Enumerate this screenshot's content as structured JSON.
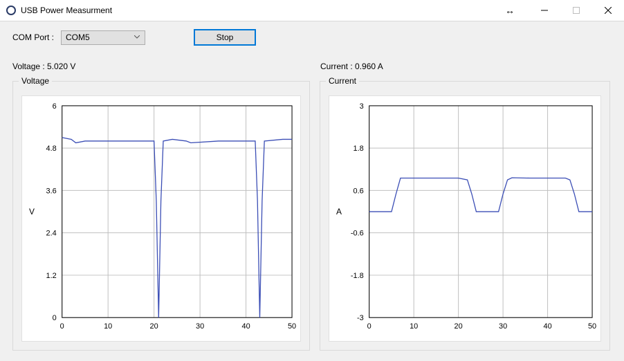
{
  "window": {
    "title": "USB Power Measurment",
    "doubleArrowGlyph": "↔"
  },
  "controls": {
    "comPortLabel": "COM Port :",
    "comPortValue": "COM5",
    "stopLabel": "Stop"
  },
  "readings": {
    "voltage": "Voltage : 5.020 V",
    "current": "Current : 0.960 A"
  },
  "groups": {
    "voltage": "Voltage",
    "current": "Current"
  },
  "chart_data": [
    {
      "type": "line",
      "title": "Voltage",
      "xlabel": "",
      "ylabel": "V",
      "xlim": [
        0,
        50
      ],
      "ylim": [
        0,
        6
      ],
      "xticks": [
        0,
        10,
        20,
        30,
        40,
        50
      ],
      "yticks": [
        0,
        1.2,
        2.4,
        3.6,
        4.8,
        6
      ],
      "x": [
        0,
        2,
        3,
        5,
        10,
        15,
        19,
        20,
        20.5,
        21,
        21.5,
        22,
        24,
        27,
        28,
        34,
        40,
        42,
        42.5,
        43,
        43.5,
        44,
        48,
        50
      ],
      "values": [
        5.1,
        5.05,
        4.95,
        5.0,
        5.0,
        5.0,
        5.0,
        5.0,
        3.3,
        0.0,
        3.3,
        5.0,
        5.05,
        5.0,
        4.95,
        5.0,
        5.0,
        5.0,
        3.3,
        0.0,
        3.3,
        5.0,
        5.05,
        5.05
      ]
    },
    {
      "type": "line",
      "title": "Current",
      "xlabel": "",
      "ylabel": "A",
      "xlim": [
        0,
        50
      ],
      "ylim": [
        -3,
        3
      ],
      "xticks": [
        0,
        10,
        20,
        30,
        40,
        50
      ],
      "yticks": [
        -3,
        -1.8,
        -0.6,
        0.6,
        1.8,
        3
      ],
      "x": [
        0,
        5,
        6,
        7,
        12,
        20,
        22,
        23,
        24,
        29,
        30,
        31,
        32,
        36,
        44,
        45,
        46,
        47,
        50,
        51,
        52
      ],
      "values": [
        0.0,
        0.0,
        0.5,
        0.95,
        0.95,
        0.95,
        0.9,
        0.5,
        0.0,
        0.0,
        0.5,
        0.9,
        0.96,
        0.95,
        0.95,
        0.9,
        0.5,
        0.0,
        0.0,
        0.1,
        0.2
      ]
    }
  ]
}
